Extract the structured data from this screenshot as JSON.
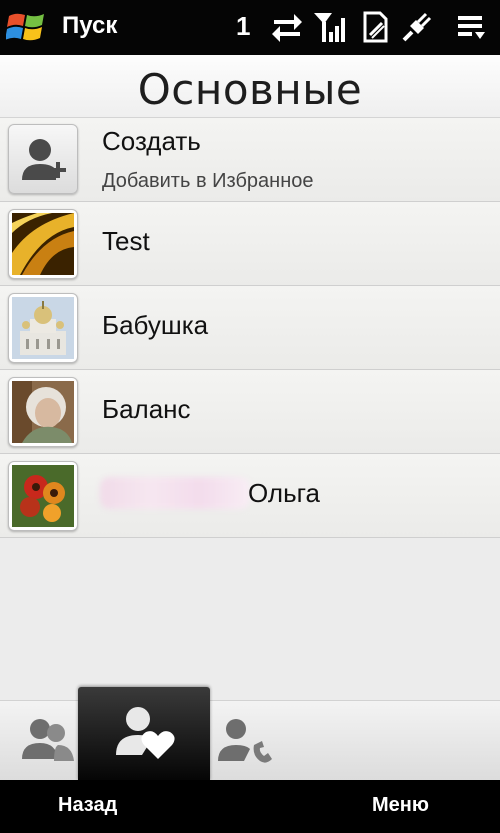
{
  "status_bar": {
    "start_label": "Пуск",
    "notification_count": "1",
    "icons": [
      "windows-logo-icon",
      "data-sync-arrows-icon",
      "signal-strength-icon",
      "no-sim-icon",
      "power-plug-icon",
      "menu-list-icon"
    ]
  },
  "header": {
    "title": "Основные"
  },
  "favorites": [
    {
      "title": "Создать",
      "subtitle": "Добавить в Избранное",
      "thumb": "add-contact-icon"
    },
    {
      "title": "Test",
      "thumb": "flower-macro-photo"
    },
    {
      "title": "Бабушка",
      "thumb": "church-photo"
    },
    {
      "title": "Баланс",
      "thumb": "person-photo"
    },
    {
      "title": "Ольга",
      "thumb": "flowers-photo",
      "name_prefix_obscured": true
    }
  ],
  "tabs": [
    {
      "id": "all-contacts",
      "icon": "contacts-icon",
      "active": false
    },
    {
      "id": "favorites",
      "icon": "favorite-heart-icon",
      "active": true
    },
    {
      "id": "call-history",
      "icon": "contact-phone-icon",
      "active": false
    }
  ],
  "softkeys": {
    "left": "Назад",
    "right": "Меню"
  },
  "colors": {
    "status_bar": "#050505",
    "background": "#ececec",
    "active_tab": "#111111",
    "text": "#111111"
  }
}
